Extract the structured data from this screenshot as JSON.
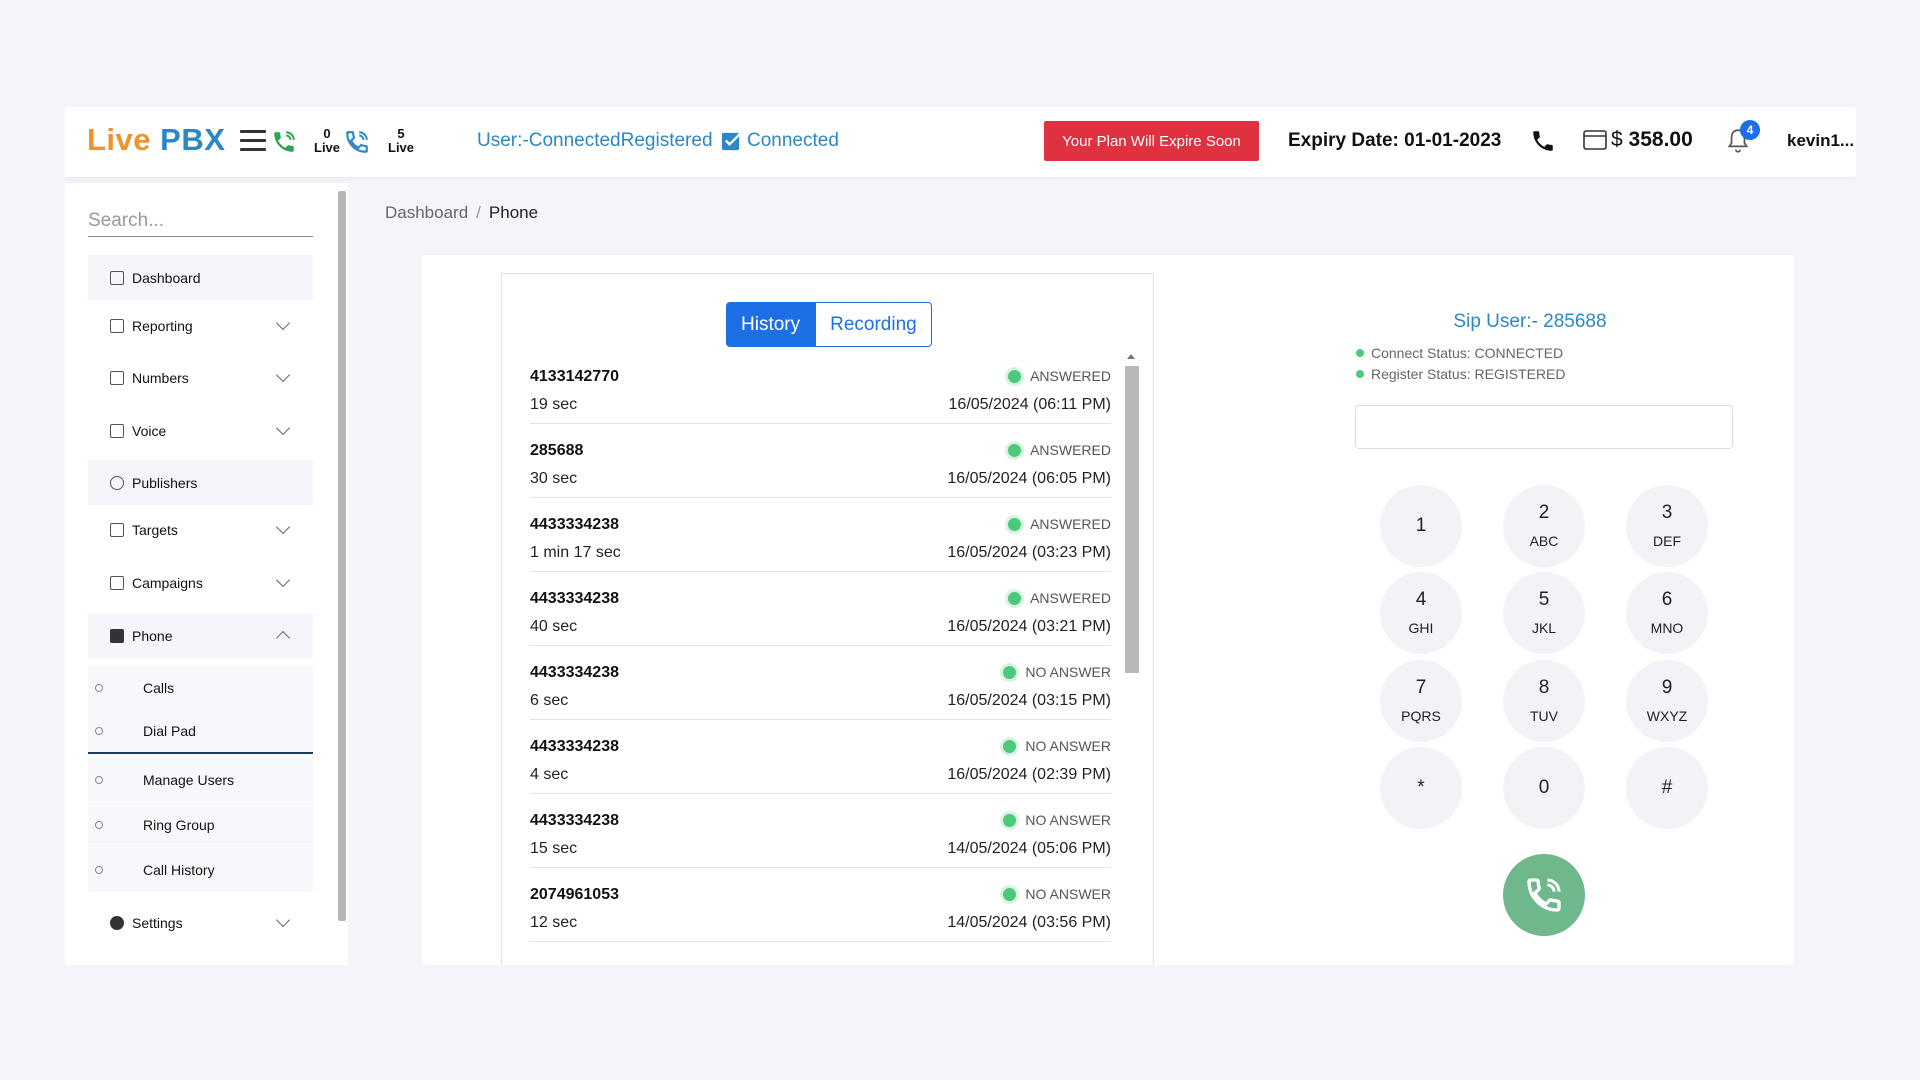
{
  "header": {
    "logo_live": "Live",
    "logo_pbx": "PBX",
    "live_counter_1": {
      "count": "0",
      "label": "Live"
    },
    "live_counter_2": {
      "count": "5",
      "label": "Live"
    },
    "user_status": "User:-ConnectedRegistered",
    "connected_label": "Connected",
    "plan_warning": "Your Plan Will Expire Soon",
    "expiry": "Expiry Date: 01-01-2023",
    "currency": "$",
    "balance": "358.00",
    "notification_count": "4",
    "username": "kevin1..."
  },
  "sidebar": {
    "search_placeholder": "Search...",
    "items": [
      {
        "label": "Dashboard"
      },
      {
        "label": "Reporting"
      },
      {
        "label": "Numbers"
      },
      {
        "label": "Voice"
      },
      {
        "label": "Publishers"
      },
      {
        "label": "Targets"
      },
      {
        "label": "Campaigns"
      },
      {
        "label": "Phone"
      },
      {
        "label": "Settings"
      }
    ],
    "phone_sub": [
      {
        "label": "Calls"
      },
      {
        "label": "Dial Pad"
      },
      {
        "label": "Manage Users"
      },
      {
        "label": "Ring Group"
      },
      {
        "label": "Call History"
      }
    ]
  },
  "breadcrumb": {
    "root": "Dashboard",
    "sep": "/",
    "current": "Phone"
  },
  "history": {
    "tabs": [
      "History",
      "Recording"
    ],
    "calls": [
      {
        "number": "4133142770",
        "duration": "19 sec",
        "status": "ANSWERED",
        "date": "16/05/2024 (06:11 PM)"
      },
      {
        "number": "285688",
        "duration": "30 sec",
        "status": "ANSWERED",
        "date": "16/05/2024 (06:05 PM)"
      },
      {
        "number": "4433334238",
        "duration": "1 min 17 sec",
        "status": "ANSWERED",
        "date": "16/05/2024 (03:23 PM)"
      },
      {
        "number": "4433334238",
        "duration": "40 sec",
        "status": "ANSWERED",
        "date": "16/05/2024 (03:21 PM)"
      },
      {
        "number": "4433334238",
        "duration": "6 sec",
        "status": "NO ANSWER",
        "date": "16/05/2024 (03:15 PM)"
      },
      {
        "number": "4433334238",
        "duration": "4 sec",
        "status": "NO ANSWER",
        "date": "16/05/2024 (02:39 PM)"
      },
      {
        "number": "4433334238",
        "duration": "15 sec",
        "status": "NO ANSWER",
        "date": "14/05/2024 (05:06 PM)"
      },
      {
        "number": "2074961053",
        "duration": "12 sec",
        "status": "NO ANSWER",
        "date": "14/05/2024 (03:56 PM)"
      }
    ]
  },
  "dialpad": {
    "sip_user": "Sip User:- 285688",
    "connect_status": "Connect Status: CONNECTED",
    "register_status": "Register Status: REGISTERED",
    "input_value": "",
    "keys": [
      {
        "digit": "1",
        "letters": ""
      },
      {
        "digit": "2",
        "letters": "ABC"
      },
      {
        "digit": "3",
        "letters": "DEF"
      },
      {
        "digit": "4",
        "letters": "GHI"
      },
      {
        "digit": "5",
        "letters": "JKL"
      },
      {
        "digit": "6",
        "letters": "MNO"
      },
      {
        "digit": "7",
        "letters": "PQRS"
      },
      {
        "digit": "8",
        "letters": "TUV"
      },
      {
        "digit": "9",
        "letters": "WXYZ"
      },
      {
        "digit": "*",
        "letters": ""
      },
      {
        "digit": "0",
        "letters": ""
      },
      {
        "digit": "#",
        "letters": ""
      }
    ]
  },
  "colors": {
    "brand_orange": "#f0932b",
    "brand_blue": "#2c87c5",
    "alert_red": "#e03140",
    "tab_blue": "#1d6fe5",
    "status_green": "#4cc97a",
    "call_button": "#6fb88b"
  }
}
